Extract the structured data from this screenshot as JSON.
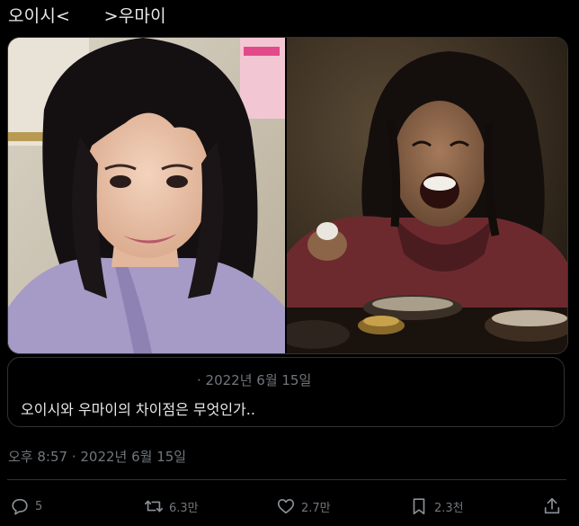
{
  "tweet": {
    "text": "오이시<      >우마이"
  },
  "media": {
    "left_alt": "woman-smiling-photo",
    "right_alt": "man-laughing-eating-photo"
  },
  "quote": {
    "meta": "· 2022년 6월 15일",
    "text": "오이시와 우마이의 차이점은 무엇인가.."
  },
  "timestamp": "오후 8:57 · 2022년 6월 15일",
  "actions": {
    "reply_count": "5",
    "retweet_count": "6.3만",
    "like_count": "2.7만",
    "bookmark_count": "2.3천"
  },
  "colors": {
    "background": "#000000",
    "text": "#e7e9ea",
    "muted": "#71767b",
    "border": "#2f3336"
  }
}
